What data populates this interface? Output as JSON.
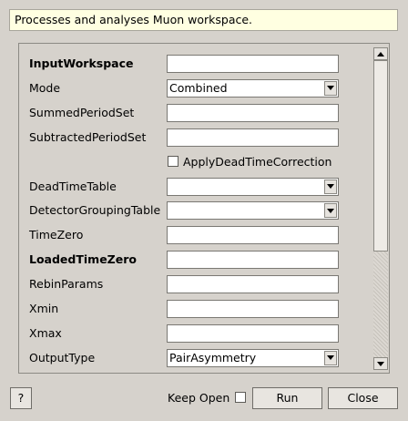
{
  "description": "Processes and analyses Muon workspace.",
  "properties": [
    {
      "kind": "text",
      "label": "InputWorkspace",
      "bold": true,
      "value": ""
    },
    {
      "kind": "combo",
      "label": "Mode",
      "bold": false,
      "value": "Combined"
    },
    {
      "kind": "text",
      "label": "SummedPeriodSet",
      "bold": false,
      "value": ""
    },
    {
      "kind": "text",
      "label": "SubtractedPeriodSet",
      "bold": false,
      "value": ""
    },
    {
      "kind": "checkbox",
      "label": "ApplyDeadTimeCorrection",
      "checked": false
    },
    {
      "kind": "combo",
      "label": "DeadTimeTable",
      "bold": false,
      "value": ""
    },
    {
      "kind": "combo",
      "label": "DetectorGroupingTable",
      "bold": false,
      "value": ""
    },
    {
      "kind": "text",
      "label": "TimeZero",
      "bold": false,
      "value": ""
    },
    {
      "kind": "text",
      "label": "LoadedTimeZero",
      "bold": true,
      "value": ""
    },
    {
      "kind": "text",
      "label": "RebinParams",
      "bold": false,
      "value": ""
    },
    {
      "kind": "text",
      "label": "Xmin",
      "bold": false,
      "value": ""
    },
    {
      "kind": "text",
      "label": "Xmax",
      "bold": false,
      "value": ""
    },
    {
      "kind": "combo",
      "label": "OutputType",
      "bold": false,
      "value": "PairAsymmetry"
    }
  ],
  "scroll_fraction": 0.0,
  "footer": {
    "help_label": "?",
    "keep_open_label": "Keep Open",
    "keep_open_checked": false,
    "run_label": "Run",
    "close_label": "Close"
  }
}
